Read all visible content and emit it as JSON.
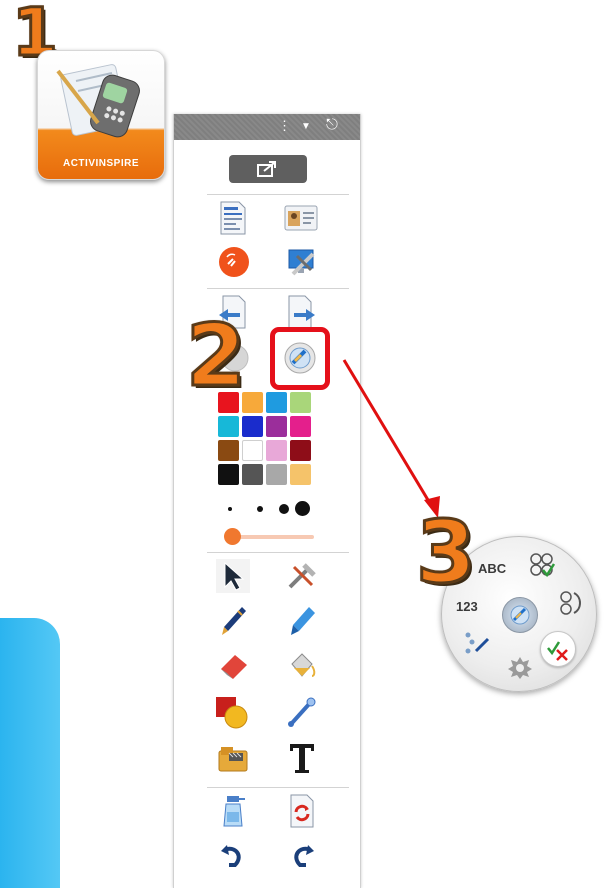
{
  "steps": {
    "one": "1",
    "two": "2",
    "three": "3"
  },
  "app_icon": {
    "label": "ACTIVINSPIRE"
  },
  "toolbox": {
    "header_icons": [
      "more-icon",
      "dropdown-icon",
      "pin-icon"
    ],
    "palette_colors": [
      "#e8141e",
      "#f7a93a",
      "#1f9be0",
      "#a9d67a",
      "#17b8d8",
      "#1a2ccc",
      "#9b2e9b",
      "#e41f8c",
      "#8a4a12",
      "#ffffff",
      "#e8a8d8",
      "#8e0d18",
      "#111111",
      "#555555",
      "#a8a8a8",
      "#f5c36a"
    ],
    "pen_sizes": [
      "small",
      "medium",
      "large",
      "xlarge"
    ],
    "slider_level": 0
  },
  "radial_menu": {
    "abc_label": "ABC",
    "number_label": "123"
  },
  "colors": {
    "accent_orange": "#f07c1c",
    "highlight_red": "#e5101a",
    "arrow_red": "#e01010",
    "panel_blue": "#3dbcf2"
  }
}
